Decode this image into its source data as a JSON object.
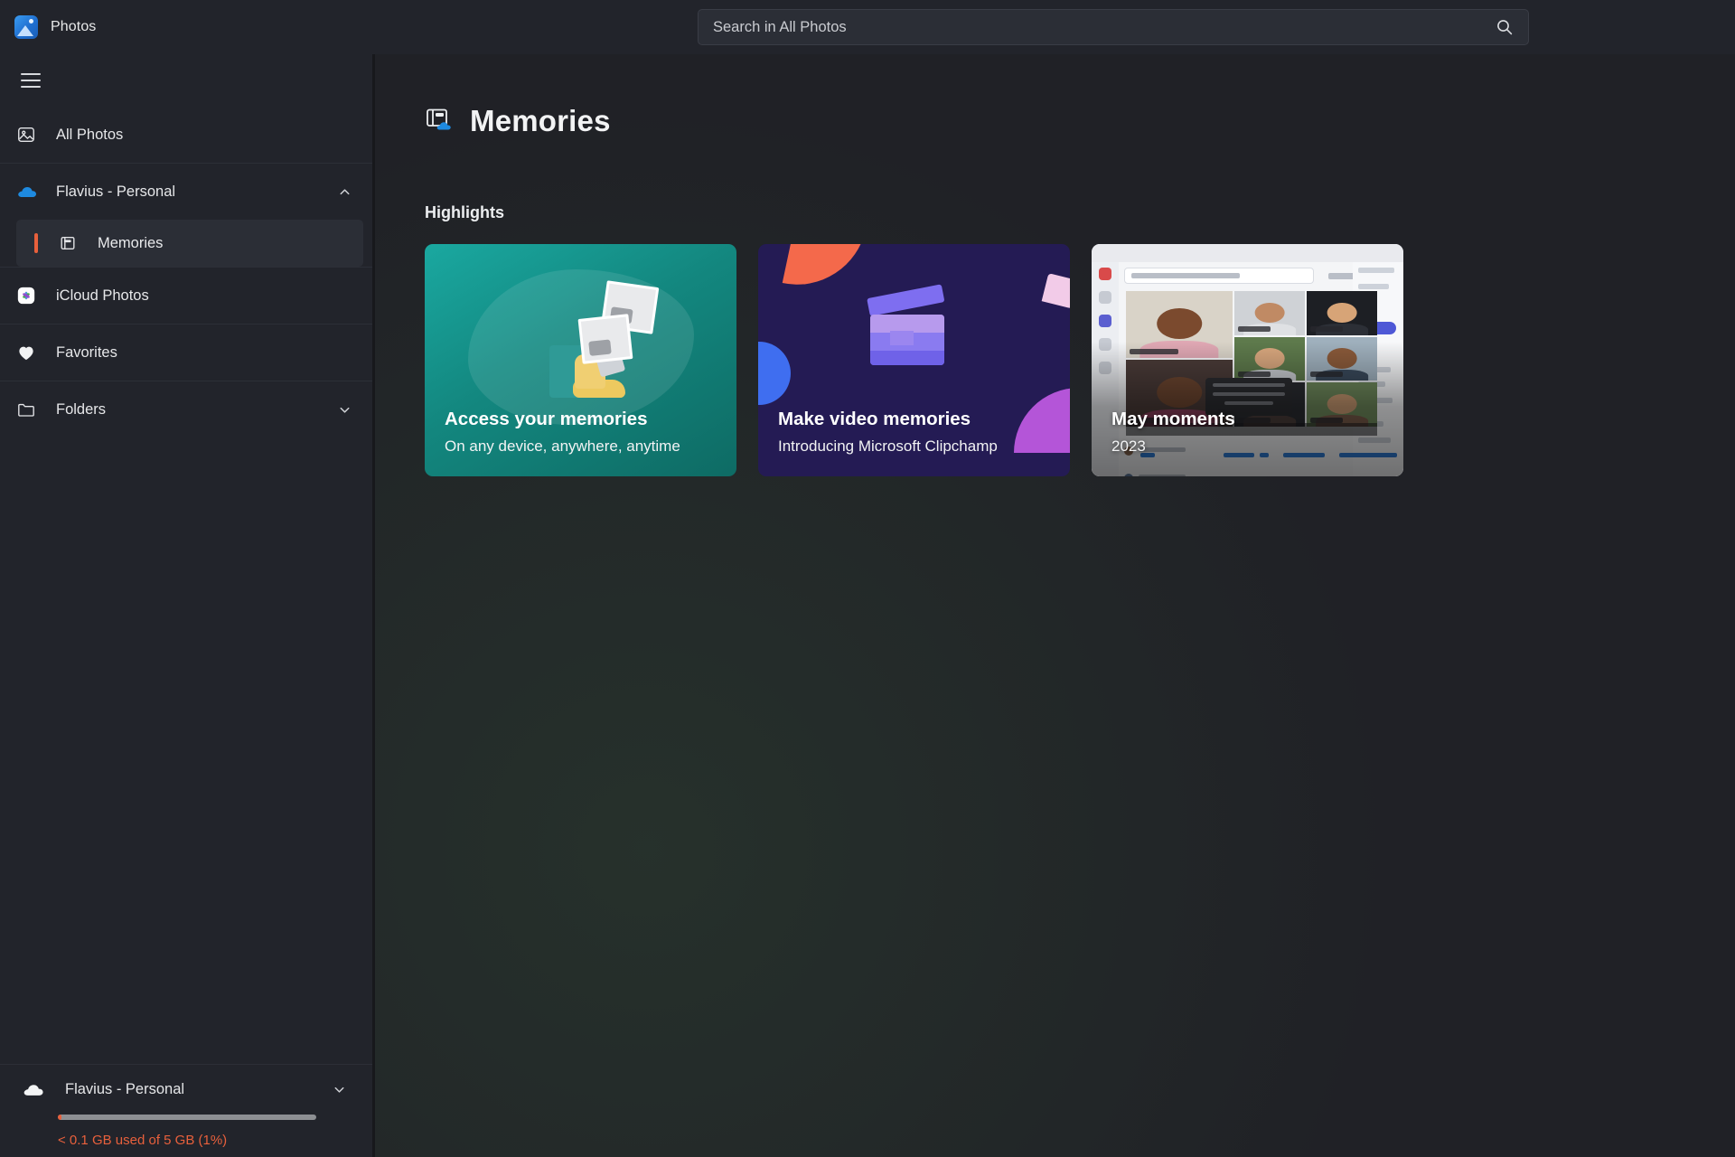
{
  "app": {
    "title": "Photos",
    "logo_icon": "photos-app-icon"
  },
  "search": {
    "placeholder": "Search in All Photos",
    "value": "",
    "icon": "search-icon"
  },
  "sidebar": {
    "menu_icon": "hamburger-menu-icon",
    "items": [
      {
        "label": "All Photos",
        "icon": "photo-icon",
        "type": "nav"
      },
      {
        "label": "Flavius - Personal",
        "icon": "onedrive-cloud-icon",
        "type": "group",
        "chevron": "chevron-up-icon",
        "expanded": true
      },
      {
        "label": "Memories",
        "icon": "memories-icon",
        "type": "sub",
        "selected": true
      },
      {
        "label": "iCloud Photos",
        "icon": "icloud-photos-icon",
        "type": "nav"
      },
      {
        "label": "Favorites",
        "icon": "heart-icon",
        "type": "nav"
      },
      {
        "label": "Folders",
        "icon": "folder-icon",
        "type": "nav",
        "chevron": "chevron-down-icon",
        "expanded": false
      }
    ],
    "storage": {
      "account_label": "Flavius - Personal",
      "account_icon": "cloud-icon",
      "chevron": "chevron-down-icon",
      "usage_text": "< 0.1 GB used of 5 GB (1%)",
      "usage_percent": 1
    }
  },
  "main": {
    "page_title": "Memories",
    "page_icon": "memories-cloud-icon",
    "section_title": "Highlights",
    "cards": [
      {
        "title": "Access your memories",
        "subtitle": "On any device, anywhere, anytime",
        "art": "illustration-person-with-photos",
        "accent": "#13877f"
      },
      {
        "title": "Make video memories",
        "subtitle": "Introducing Microsoft Clipchamp",
        "art": "clapperboard-illustration",
        "accent": "#241b54"
      },
      {
        "title": "May moments",
        "subtitle": "2023",
        "art": "teams-meeting-screenshot",
        "accent": "#1d1e22"
      }
    ]
  },
  "colors": {
    "window_bg": "#202126",
    "chrome_bg": "#22242b",
    "accent_selection": "#e8603c",
    "text_primary": "#e8e9ea"
  }
}
